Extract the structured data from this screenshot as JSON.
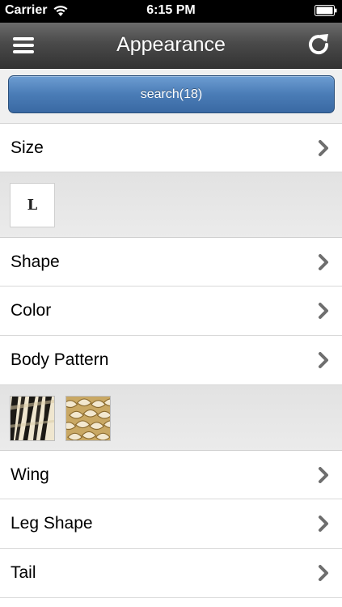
{
  "status_bar": {
    "carrier": "Carrier",
    "time": "6:15 PM"
  },
  "nav": {
    "title": "Appearance",
    "left_icon": "menu-icon",
    "right_icon": "refresh-icon"
  },
  "search": {
    "label": "search(18)",
    "color": "#4a7cb6"
  },
  "rows": {
    "size": "Size",
    "shape": "Shape",
    "color": "Color",
    "body_pattern": "Body Pattern",
    "wing": "Wing",
    "leg_shape": "Leg Shape",
    "tail": "Tail"
  },
  "size_selection": {
    "value": "L"
  },
  "pattern_selection": {
    "thumbnails": [
      "zebra-stripe-pattern",
      "gold-scale-pattern"
    ]
  }
}
